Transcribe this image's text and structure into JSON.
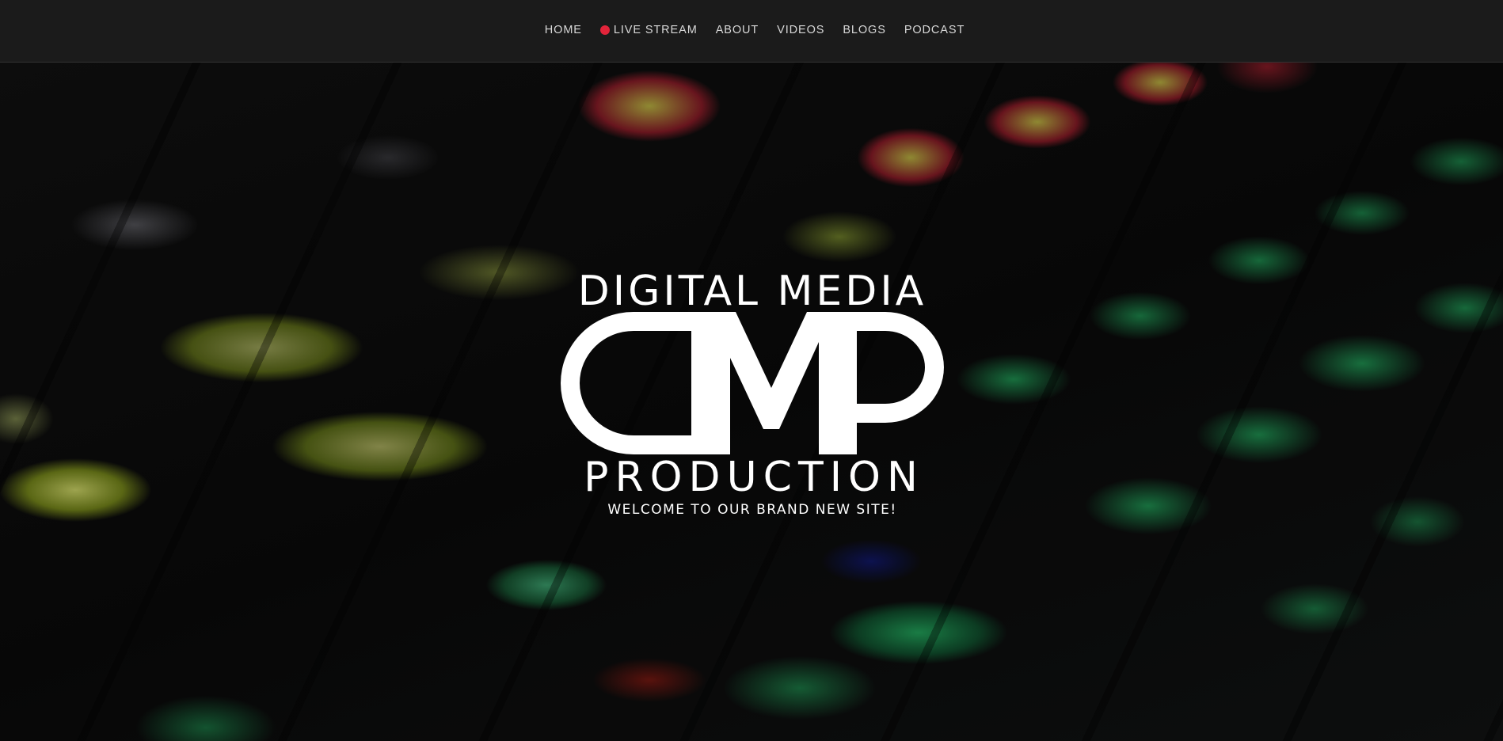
{
  "nav": {
    "items": [
      {
        "label": "HOME"
      },
      {
        "label": "LIVE STREAM",
        "indicator_color": "#e2243a"
      },
      {
        "label": "ABOUT"
      },
      {
        "label": "VIDEOS"
      },
      {
        "label": "BLOGS"
      },
      {
        "label": "PODCAST"
      }
    ]
  },
  "hero": {
    "logo_top": "DIGITAL MEDIA",
    "logo_bottom": "PRODUCTION",
    "tagline": "WELCOME TO OUR BRAND NEW SITE!",
    "logo_color": "#ffffff"
  }
}
